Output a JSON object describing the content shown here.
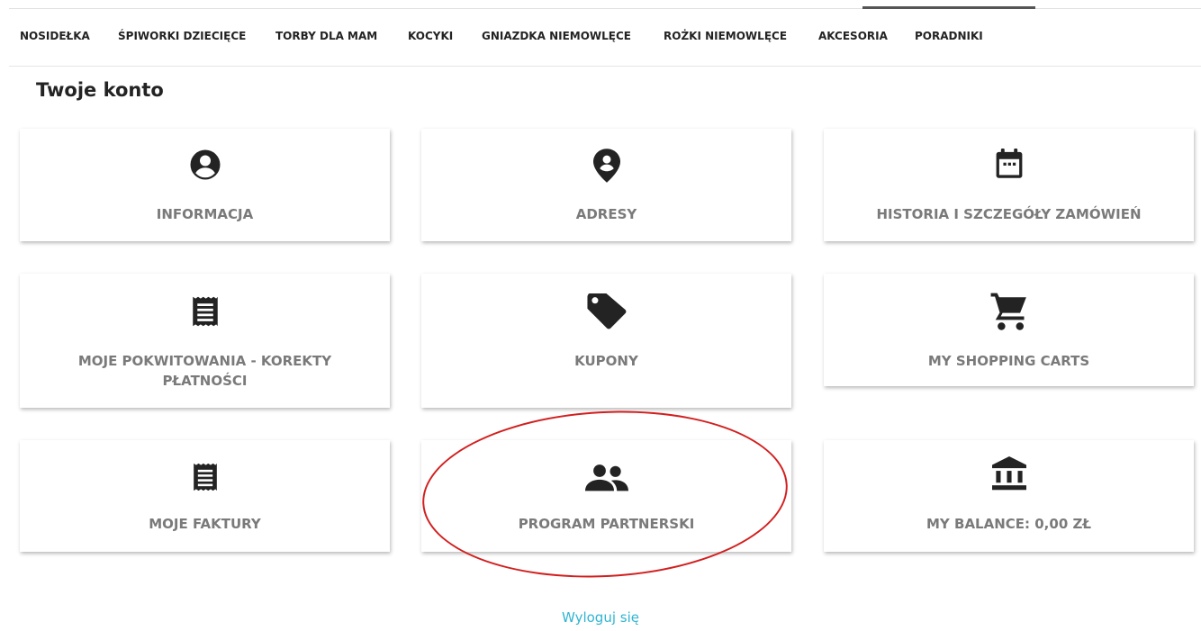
{
  "nav": {
    "items": [
      "NOSIDEŁKA",
      "ŚPIWORKI DZIECIĘCE",
      "TORBY DLA MAM",
      "KOCYKI",
      "GNIAZDKA NIEMOWLĘCE",
      "ROŻKI NIEMOWLĘCE",
      "AKCESORIA",
      "PORADNIKI"
    ]
  },
  "page": {
    "title": "Twoje konto"
  },
  "tiles": [
    {
      "label": "INFORMACJA",
      "icon": "account-circle-icon"
    },
    {
      "label": "ADRESY",
      "icon": "map-pin-icon"
    },
    {
      "label": "HISTORIA I SZCZEGÓŁY ZAMÓWIEŃ",
      "icon": "calendar-icon"
    },
    {
      "label": "MOJE POKWITOWANIA - KOREKTY PŁATNOŚCI",
      "icon": "receipt-icon"
    },
    {
      "label": "KUPONY",
      "icon": "tag-icon"
    },
    {
      "label": "MY SHOPPING CARTS",
      "icon": "shopping-cart-icon"
    },
    {
      "label": "MOJE FAKTURY",
      "icon": "receipt-icon"
    },
    {
      "label": "PROGRAM PARTNERSKI",
      "icon": "group-icon"
    },
    {
      "label": "MY BALANCE: 0,00 ZŁ",
      "icon": "bank-icon"
    }
  ],
  "footer": {
    "logout": "Wyloguj się"
  },
  "colors": {
    "link": "#2fb5d2",
    "annotation": "#d21f1f",
    "tile_label": "#7a7a7a"
  }
}
